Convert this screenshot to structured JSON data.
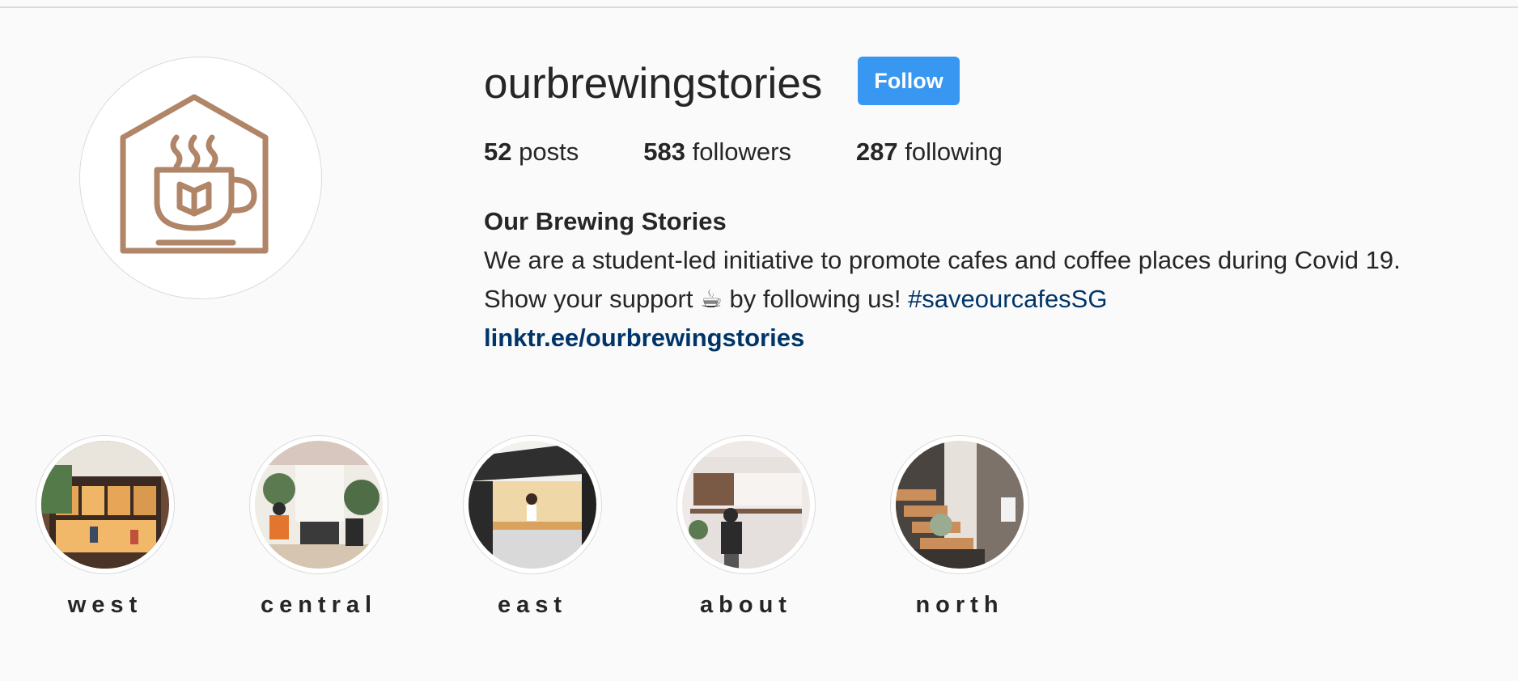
{
  "profile": {
    "username": "ourbrewingstories",
    "follow_label": "Follow",
    "stats": {
      "posts_count": "52",
      "posts_label": "posts",
      "followers_count": "583",
      "followers_label": "followers",
      "following_count": "287",
      "following_label": "following"
    },
    "bio": {
      "name": "Our Brewing Stories",
      "line1": "We are a student-led initiative to promote cafes and coffee places during Covid 19.",
      "line2_prefix": "Show your support ☕ by following us! ",
      "hashtag": "#saveourcafesSG",
      "link": "linktr.ee/ourbrewingstories"
    },
    "avatar_icon": "house-coffee-book-logo",
    "brand_color": "#b08568",
    "follow_color": "#3897f0",
    "link_color": "#003569"
  },
  "highlights": [
    {
      "label": "west"
    },
    {
      "label": "central"
    },
    {
      "label": "east"
    },
    {
      "label": "about"
    },
    {
      "label": "north"
    }
  ]
}
